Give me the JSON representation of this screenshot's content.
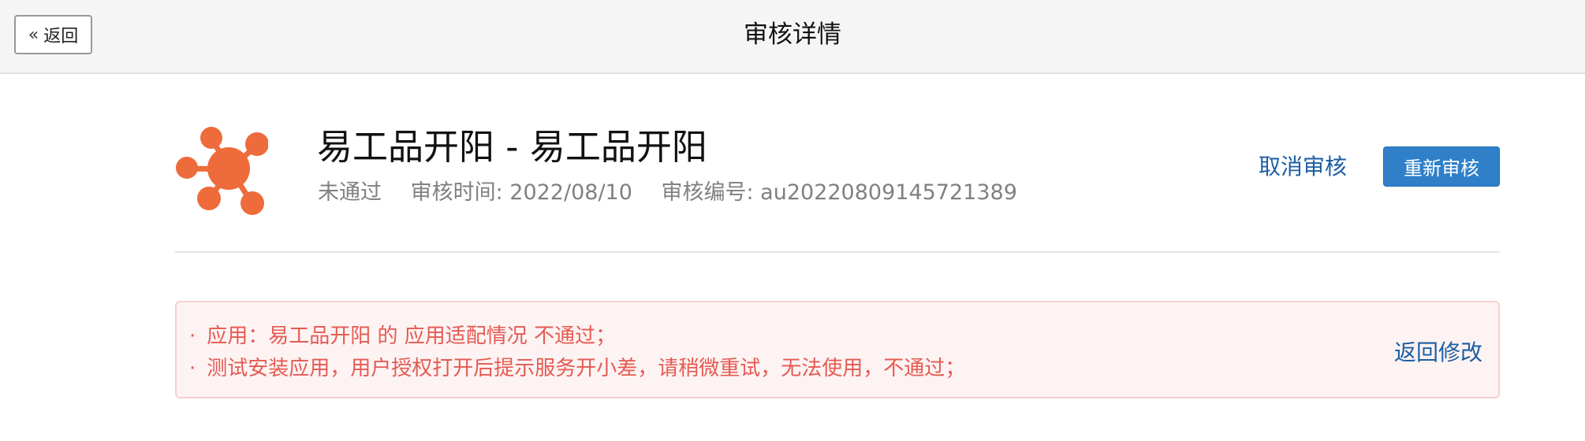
{
  "header": {
    "back_label": "返回",
    "back_icon": "double-chevron-left-icon",
    "title": "审核详情"
  },
  "app": {
    "icon": "molecule-network-icon",
    "icon_color": "#ee6b3b",
    "name": "易工品开阳 - 易工品开阳",
    "status": "未通过",
    "review_time": "审核时间: 2022/08/10",
    "review_id": "审核编号: au20220809145721389"
  },
  "actions": {
    "cancel_label": "取消审核",
    "resubmit_label": "重新审核",
    "link_color": "#1c5ea3",
    "primary_color": "#2f80c9"
  },
  "reasons": {
    "bullet": "·",
    "items": [
      "应用：易工品开阳 的 应用适配情况 不通过；",
      "测试安装应用，用户授权打开后提示服务开小差，请稍微重试，无法使用，不通过；"
    ],
    "text_color": "#e55a52",
    "return_edit_label": "返回修改"
  }
}
